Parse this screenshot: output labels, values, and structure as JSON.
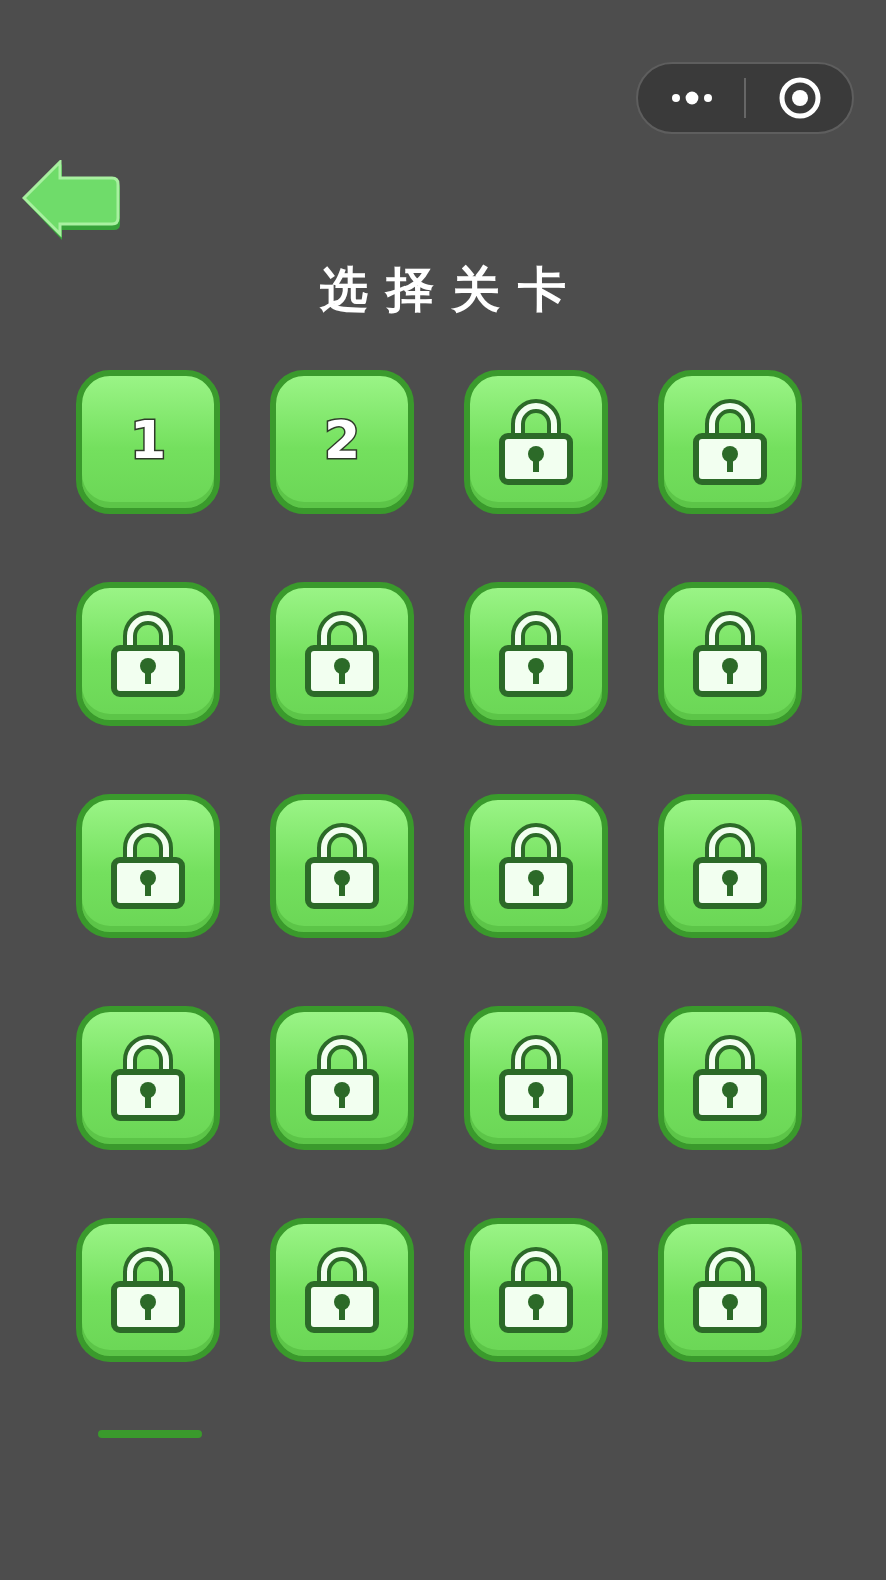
{
  "title": "选择关卡",
  "levels": [
    {
      "label": "1",
      "locked": false
    },
    {
      "label": "2",
      "locked": false
    },
    {
      "locked": true
    },
    {
      "locked": true
    },
    {
      "locked": true
    },
    {
      "locked": true
    },
    {
      "locked": true
    },
    {
      "locked": true
    },
    {
      "locked": true
    },
    {
      "locked": true
    },
    {
      "locked": true
    },
    {
      "locked": true
    },
    {
      "locked": true
    },
    {
      "locked": true
    },
    {
      "locked": true
    },
    {
      "locked": true
    },
    {
      "locked": true
    },
    {
      "locked": true
    },
    {
      "locked": true
    },
    {
      "locked": true
    }
  ]
}
